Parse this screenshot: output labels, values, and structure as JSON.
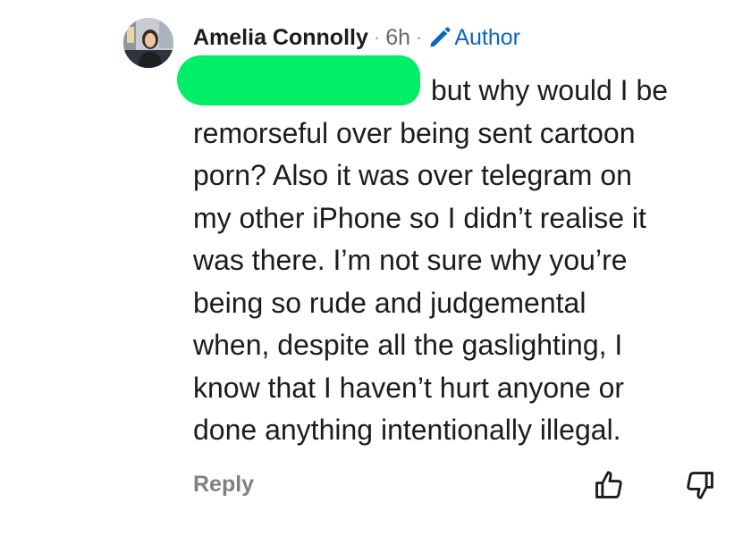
{
  "comment": {
    "author": "Amelia Connolly",
    "separator": "·",
    "time": "6h",
    "badge": "Author",
    "body_lines": [
      "but why would I be",
      "remorseful over being sent cartoon",
      "porn? Also it was over telegram on",
      "my other iPhone so I didn’t realise it",
      "was there. I’m not sure why you’re",
      "being so rude and judgemental",
      "when, despite all the gaslighting, I",
      "know that I haven’t hurt anyone or",
      "done anything intentionally illegal."
    ],
    "reply_label": "Reply"
  },
  "icons": {
    "badge_icon": "pencil-icon",
    "upvote_icon": "thumbs-up-icon",
    "downvote_icon": "thumbs-down-icon"
  },
  "colors": {
    "author_badge": "#0a66c2",
    "redaction": "#00ee66",
    "muted": "#808080"
  }
}
